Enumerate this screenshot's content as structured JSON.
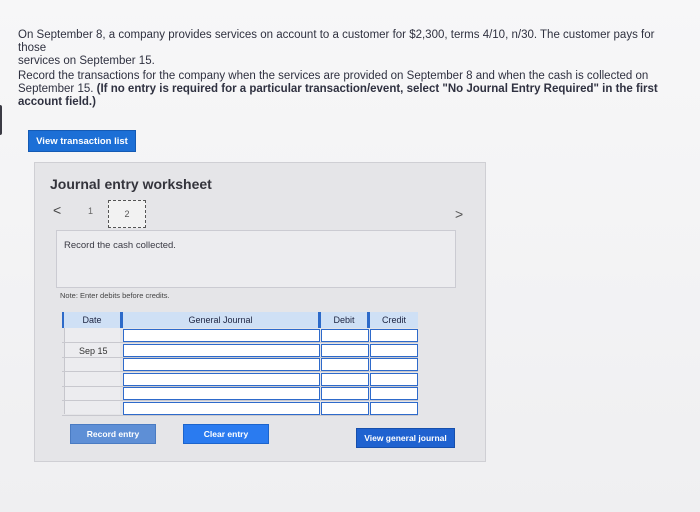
{
  "question": {
    "line1": "On September 8, a company provides services on account to a customer for $2,300, terms 4/10, n/30. The customer pays for those",
    "line2": "services on September 15."
  },
  "instructions": {
    "text": "Record the transactions for the company when the services are provided on September 8 and when the cash is collected on September 15.",
    "bold": "(If no entry is required for a particular transaction/event, select \"No Journal Entry Required\" in the first account field.)"
  },
  "buttons": {
    "view_transaction_list": "View transaction list",
    "record_entry": "Record entry",
    "clear_entry": "Clear entry",
    "view_general_journal": "View general journal"
  },
  "worksheet": {
    "title": "Journal entry worksheet",
    "nav_prev": "<",
    "nav_next": ">",
    "page_1": "1",
    "page_2": "2",
    "description": "Record the cash collected.",
    "note": "Note: Enter debits before credits."
  },
  "table": {
    "headers": {
      "date": "Date",
      "general_journal": "General Journal",
      "debit": "Debit",
      "credit": "Credit"
    },
    "date_value": "Sep 15",
    "row_count": 6
  },
  "colors": {
    "primary_blue": "#1c6fd6",
    "header_blue": "#2d6ac9"
  }
}
